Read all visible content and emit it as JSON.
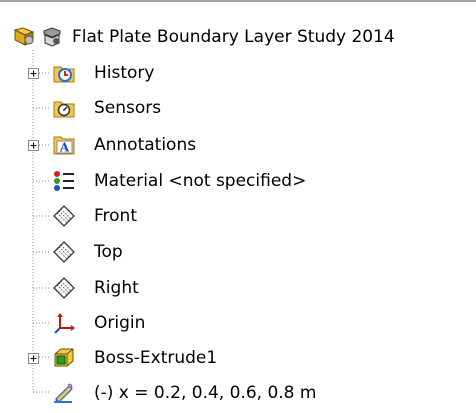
{
  "tree": {
    "root": {
      "label": "Flat Plate Boundary Layer Study 2014",
      "icon": "part-icon",
      "icon2": "display-state-icon"
    },
    "items": [
      {
        "label": "History",
        "icon": "history-folder-icon",
        "expandable": true
      },
      {
        "label": "Sensors",
        "icon": "sensors-folder-icon",
        "expandable": false
      },
      {
        "label": "Annotations",
        "icon": "annotations-folder-icon",
        "expandable": true
      },
      {
        "label": "Material <not specified>",
        "icon": "material-icon",
        "expandable": false
      },
      {
        "label": "Front",
        "icon": "plane-icon",
        "expandable": false
      },
      {
        "label": "Top",
        "icon": "plane-icon",
        "expandable": false
      },
      {
        "label": "Right",
        "icon": "plane-icon",
        "expandable": false
      },
      {
        "label": "Origin",
        "icon": "origin-icon",
        "expandable": false
      },
      {
        "label": "Boss-Extrude1",
        "icon": "extrude-feature-icon",
        "expandable": true
      },
      {
        "label": "(-) x = 0.2, 0.4, 0.6, 0.8  m",
        "icon": "sketch-icon",
        "expandable": false
      }
    ]
  },
  "colors": {
    "folder": "#f3c84a",
    "guide": "#8a8a8a",
    "text": "#000000",
    "plane": "#3a3a3a",
    "sketch": "#2f6fd0",
    "accent_red": "#d02020"
  }
}
